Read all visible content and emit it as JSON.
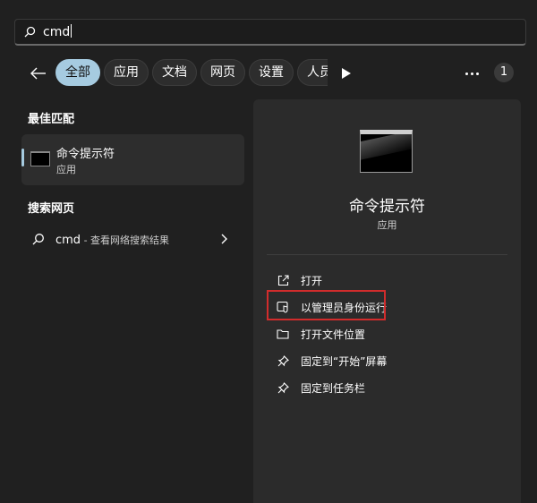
{
  "search": {
    "query": "cmd",
    "icon": "search-icon"
  },
  "filters": {
    "back_icon": "arrow-left-icon",
    "pills": [
      "全部",
      "应用",
      "文档",
      "网页",
      "设置",
      "人员"
    ],
    "active_index": 0,
    "play_icon": "play-icon",
    "more_icon": "ellipsis-icon",
    "badge": "1"
  },
  "best_match": {
    "heading": "最佳匹配",
    "title": "命令提示符",
    "subtitle": "应用",
    "icon": "command-prompt-icon"
  },
  "web_search": {
    "heading": "搜索网页",
    "query": "cmd",
    "suffix": " - 查看网络搜索结果",
    "chevron_icon": "chevron-right-icon"
  },
  "preview": {
    "title": "命令提示符",
    "subtitle": "应用",
    "actions": [
      {
        "label": "打开",
        "icon": "open-external-icon"
      },
      {
        "label": "以管理员身份运行",
        "icon": "shield-admin-icon"
      },
      {
        "label": "打开文件位置",
        "icon": "folder-icon"
      },
      {
        "label": "固定到“开始”屏幕",
        "icon": "pin-icon"
      },
      {
        "label": "固定到任务栏",
        "icon": "pin-icon"
      }
    ]
  },
  "colors": {
    "background": "#202020",
    "panel": "#2b2b2b",
    "accent": "#a6cbe0",
    "highlight": "#d22c2c"
  }
}
